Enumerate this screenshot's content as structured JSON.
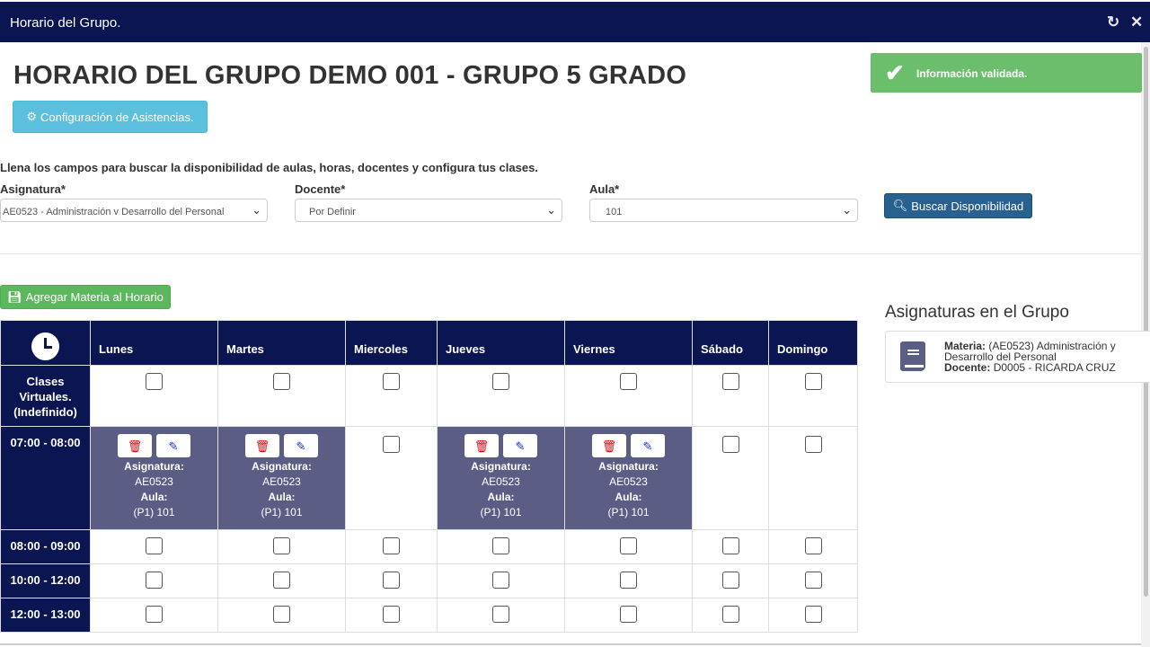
{
  "window": {
    "title": "Horario del Grupo.",
    "reload_icon": "reload-icon",
    "close_icon": "close-icon"
  },
  "page": {
    "title": "HORARIO DEL GRUPO DEMO 001 - GRUPO 5 GRADO",
    "config_button": "Configuración de Asistencias.",
    "hint": "Llena los campos para buscar la disponibilidad de aulas, horas, docentes y configura tus clases."
  },
  "toast": {
    "message": "Información validada.",
    "color": "#5cb85c"
  },
  "form": {
    "asignatura_label": "Asignatura*",
    "asignatura_value": "AE0523 - Administración v Desarrollo del Personal",
    "docente_label": "Docente*",
    "docente_value": "Por Definir",
    "aula_label": "Aula*",
    "aula_value": "101",
    "search_button": "Buscar Disponibilidad"
  },
  "add_button": "Agregar Materia al Horario",
  "schedule": {
    "days": [
      "Lunes",
      "Martes",
      "Miercoles",
      "Jueves",
      "Viernes",
      "Sábado",
      "Domingo"
    ],
    "rows": [
      {
        "time": "Clases Virtuales. (Indefinido)",
        "cells": [
          false,
          false,
          false,
          false,
          false,
          false,
          false
        ]
      },
      {
        "time": "07:00 - 08:00",
        "cells": [
          true,
          true,
          false,
          true,
          true,
          false,
          false
        ]
      },
      {
        "time": "08:00 - 09:00",
        "cells": [
          false,
          false,
          false,
          false,
          false,
          false,
          false
        ]
      },
      {
        "time": "10:00 - 12:00",
        "cells": [
          false,
          false,
          false,
          false,
          false,
          false,
          false
        ]
      },
      {
        "time": "12:00 - 13:00",
        "cells": [
          false,
          false,
          false,
          false,
          false,
          false,
          false
        ]
      }
    ],
    "class_block": {
      "asignatura_label": "Asignatura:",
      "asignatura_value": "AE0523",
      "aula_label": "Aula:",
      "aula_value": "(P1) 101"
    },
    "header_color": "#0b1552",
    "filled_color": "#5b5d85"
  },
  "aside": {
    "title": "Asignaturas en el Grupo",
    "materia_label": "Materia:",
    "materia_value": "(AE0523) Administración y Desarrollo del Personal",
    "docente_label": "Docente:",
    "docente_value": "D0005 - RICARDA CRUZ"
  }
}
